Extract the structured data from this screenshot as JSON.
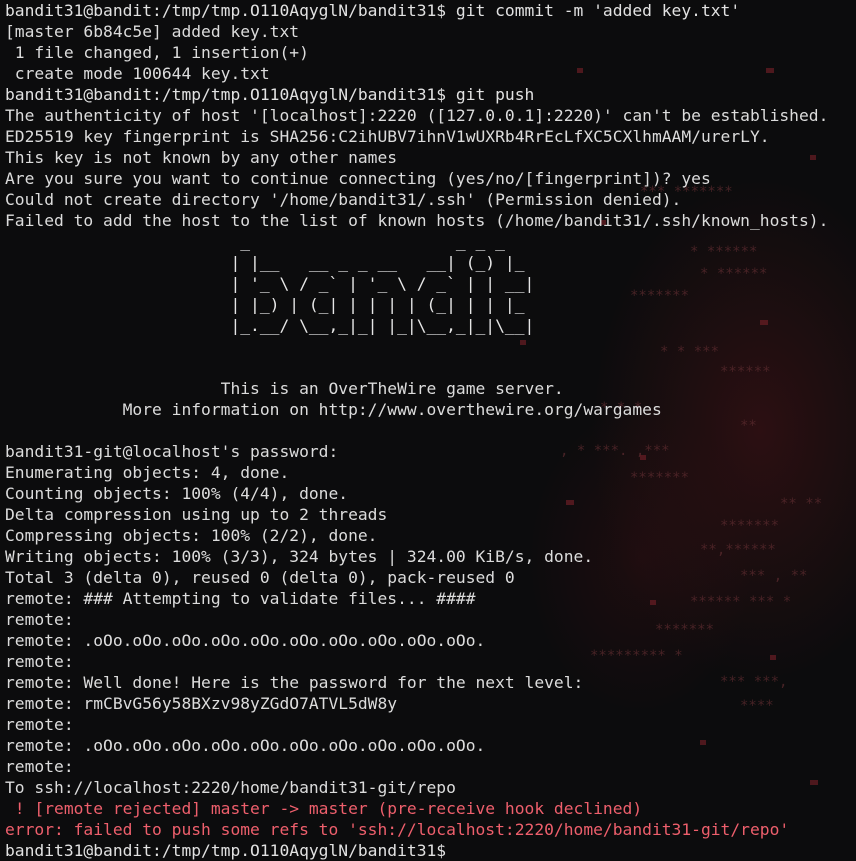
{
  "terminal": {
    "lines": [
      "bandit31@bandit:/tmp/tmp.O110AqyglN/bandit31$ git commit -m 'added key.txt'",
      "[master 6b84c5e] added key.txt",
      " 1 file changed, 1 insertion(+)",
      " create mode 100644 key.txt",
      "bandit31@bandit:/tmp/tmp.O110AqyglN/bandit31$ git push",
      "The authenticity of host '[localhost]:2220 ([127.0.0.1]:2220)' can't be established.",
      "ED25519 key fingerprint is SHA256:C2ihUBV7ihnV1wUXRb4RrEcLfXC5CXlhmAAM/urerLY.",
      "This key is not known by any other names",
      "Are you sure you want to continue connecting (yes/no/[fingerprint])? yes",
      "Could not create directory '/home/bandit31/.ssh' (Permission denied).",
      "Failed to add the host to the list of known hosts (/home/bandit31/.ssh/known_hosts).",
      "                        _                     _ _ _",
      "                       | |__   __ _ _ __   __| (_) |_",
      "                       | '_ \\ / _` | '_ \\ / _` | | __|",
      "                       | |_) | (_| | | | | (_| | | |_",
      "                       |_.__/ \\__,_|_| |_|\\__,_|_|\\__|",
      "",
      "",
      "                      This is an OverTheWire game server.",
      "            More information on http://www.overthewire.org/wargames",
      "",
      "bandit31-git@localhost's password:",
      "Enumerating objects: 4, done.",
      "Counting objects: 100% (4/4), done.",
      "Delta compression using up to 2 threads",
      "Compressing objects: 100% (2/2), done.",
      "Writing objects: 100% (3/3), 324 bytes | 324.00 KiB/s, done.",
      "Total 3 (delta 0), reused 0 (delta 0), pack-reused 0",
      "remote: ### Attempting to validate files... ####",
      "remote:",
      "remote: .oOo.oOo.oOo.oOo.oOo.oOo.oOo.oOo.oOo.oOo.",
      "remote:",
      "remote: Well done! Here is the password for the next level:",
      "remote: rmCBvG56y58BXzv98yZGdO7ATVL5dW8y",
      "remote:",
      "remote: .oOo.oOo.oOo.oOo.oOo.oOo.oOo.oOo.oOo.oOo.",
      "remote:",
      "To ssh://localhost:2220/home/bandit31-git/repo",
      " ! [remote rejected] master -> master (pre-receive hook declined)",
      "error: failed to push some refs to 'ssh://localhost:2220/home/bandit31-git/repo'",
      "bandit31@bandit:/tmp/tmp.O110AqyglN/bandit31$"
    ]
  },
  "colors": {
    "foreground": "#dcdcdc",
    "error": "#ee5f6c",
    "background": "#0c0c0d"
  }
}
